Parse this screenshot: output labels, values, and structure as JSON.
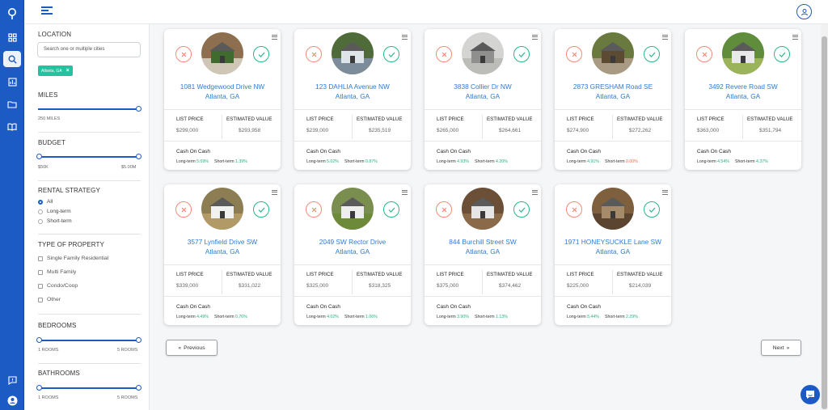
{
  "sidebar": {
    "location_title": "LOCATION",
    "search_placeholder": "Search one or multiple cities",
    "tag_label": "Atlanta, GA",
    "tag_remove": "×",
    "miles_title": "MILES",
    "miles_value": "250 MILES",
    "budget_title": "BUDGET",
    "budget_min": "$50K",
    "budget_max": "$5.00M",
    "rental_title": "RENTAL STRATEGY",
    "rental_options": [
      "All",
      "Long-term",
      "Short-term"
    ],
    "rental_selected": "All",
    "property_title": "TYPE OF PROPERTY",
    "property_options": [
      "Single Family Residential",
      "Multi Family",
      "Condo/Coop",
      "Other"
    ],
    "bedrooms_title": "BEDROOMS",
    "bed_min": "1 ROOMS",
    "bed_max": "5 ROOMS",
    "bathrooms_title": "BATHROOMS",
    "bath_min": "1 ROOMS",
    "bath_max": "5 ROOMS"
  },
  "labels": {
    "list_price": "LIST PRICE",
    "estimated_value": "ESTIMATED VALUE",
    "cash_on_cash": "Cash On Cash",
    "long_term": "Long-term",
    "short_term": "Short-term"
  },
  "cards": [
    {
      "street": "1081 Wedgewood Drive NW",
      "city": "Atlanta, GA",
      "list_price": "$299,000",
      "estimated_value": "$293,958",
      "long": "5.09%",
      "short": "1.39%",
      "short_neg": false
    },
    {
      "street": "123 DAHLIA Avenue NW",
      "city": "Atlanta, GA",
      "list_price": "$239,000",
      "estimated_value": "$235,519",
      "long": "5.02%",
      "short": "0.87%",
      "short_neg": false
    },
    {
      "street": "3838 Collier Dr NW",
      "city": "Atlanta, GA",
      "list_price": "$265,000",
      "estimated_value": "$264,661",
      "long": "4.93%",
      "short": "4.20%",
      "short_neg": false
    },
    {
      "street": "2873 GRESHAM Road SE",
      "city": "Atlanta, GA",
      "list_price": "$274,900",
      "estimated_value": "$272,262",
      "long": "4.91%",
      "short": "0.00%",
      "short_neg": true
    },
    {
      "street": "3492 Revere Road SW",
      "city": "Atlanta, GA",
      "list_price": "$363,000",
      "estimated_value": "$351,794",
      "long": "4.54%",
      "short": "4.37%",
      "short_neg": false
    },
    {
      "street": "3577 Lynfield Drive SW",
      "city": "Atlanta, GA",
      "list_price": "$339,000",
      "estimated_value": "$331,022",
      "long": "4.49%",
      "short": "0.76%",
      "short_neg": false
    },
    {
      "street": "2049 SW Rector Drive",
      "city": "Atlanta, GA",
      "list_price": "$325,000",
      "estimated_value": "$318,325",
      "long": "4.02%",
      "short": "1.06%",
      "short_neg": false
    },
    {
      "street": "844 Burchill Street SW",
      "city": "Atlanta, GA",
      "list_price": "$375,000",
      "estimated_value": "$374,462",
      "long": "3.90%",
      "short": "1.13%",
      "short_neg": false
    },
    {
      "street": "1971 HONEYSUCKLE Lane SW",
      "city": "Atlanta, GA",
      "list_price": "$225,000",
      "estimated_value": "$214,039",
      "long": "5.44%",
      "short": "2.29%",
      "short_neg": false
    }
  ],
  "pagination": {
    "previous": "Previous",
    "next": "Next"
  },
  "colors": {
    "accent": "#1d5bc4",
    "reject": "#f18b74",
    "approve": "#29b58c",
    "positive": "#22b07d",
    "negative": "#ef6a4d",
    "tag": "#25c2a0"
  },
  "icons": [
    "logo-pin-icon",
    "dashboard-grid-icon",
    "search-icon",
    "analytics-icon",
    "folder-icon",
    "book-icon",
    "feedback-icon",
    "user-icon",
    "menu-icon",
    "chat-icon",
    "close-icon",
    "check-icon",
    "card-menu-icon"
  ]
}
